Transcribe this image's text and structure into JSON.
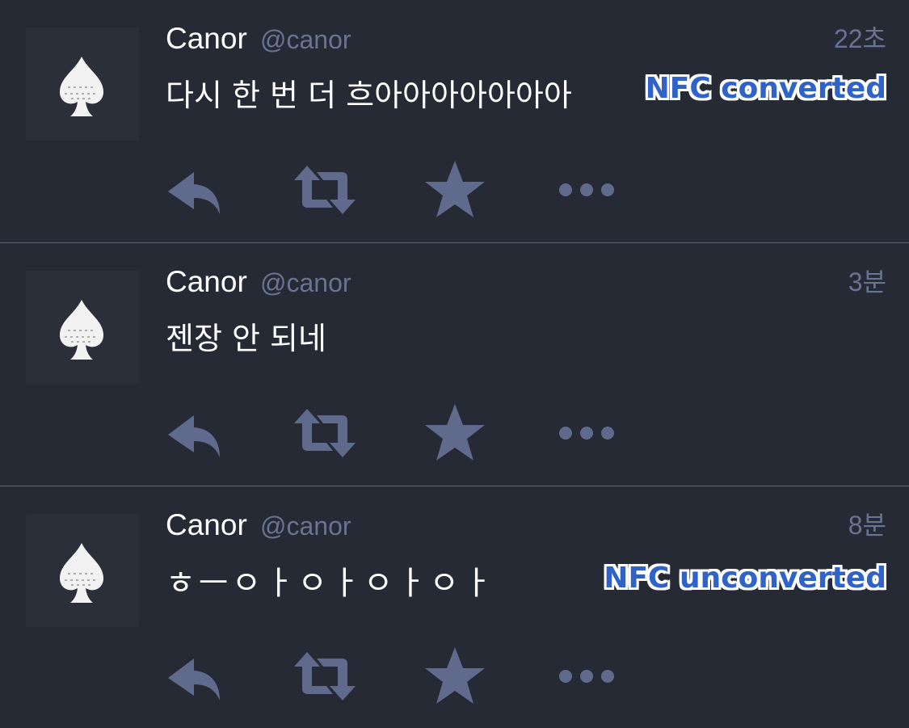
{
  "tweets": [
    {
      "author": "Canor",
      "handle": "@canor",
      "time": "22초",
      "text": "다시 한 번 더 흐아아아아아아아",
      "badge": "NFC converted",
      "avatar_icon": "spade-icon",
      "actions": [
        "reply-icon",
        "retweet-icon",
        "favorite-star-icon",
        "more-dots-icon"
      ]
    },
    {
      "author": "Canor",
      "handle": "@canor",
      "time": "3분",
      "text": "젠장 안 되네",
      "badge": "",
      "avatar_icon": "spade-icon",
      "actions": [
        "reply-icon",
        "retweet-icon",
        "favorite-star-icon",
        "more-dots-icon"
      ]
    },
    {
      "author": "Canor",
      "handle": "@canor",
      "time": "8분",
      "text": "ㅎㅡㅇㅏㅇㅏㅇㅏㅇㅏ",
      "badge": "NFC unconverted",
      "avatar_icon": "spade-icon",
      "actions": [
        "reply-icon",
        "retweet-icon",
        "favorite-star-icon",
        "more-dots-icon"
      ]
    }
  ],
  "colors": {
    "background": "#262a35",
    "avatar_bg": "#2b2f3a",
    "divider": "#5c6175",
    "name_text": "#ffffff",
    "meta_text": "#6a7392",
    "action_icon": "#5f6a8c",
    "badge_text": "#2f63c8",
    "badge_outline": "#ffffff"
  }
}
